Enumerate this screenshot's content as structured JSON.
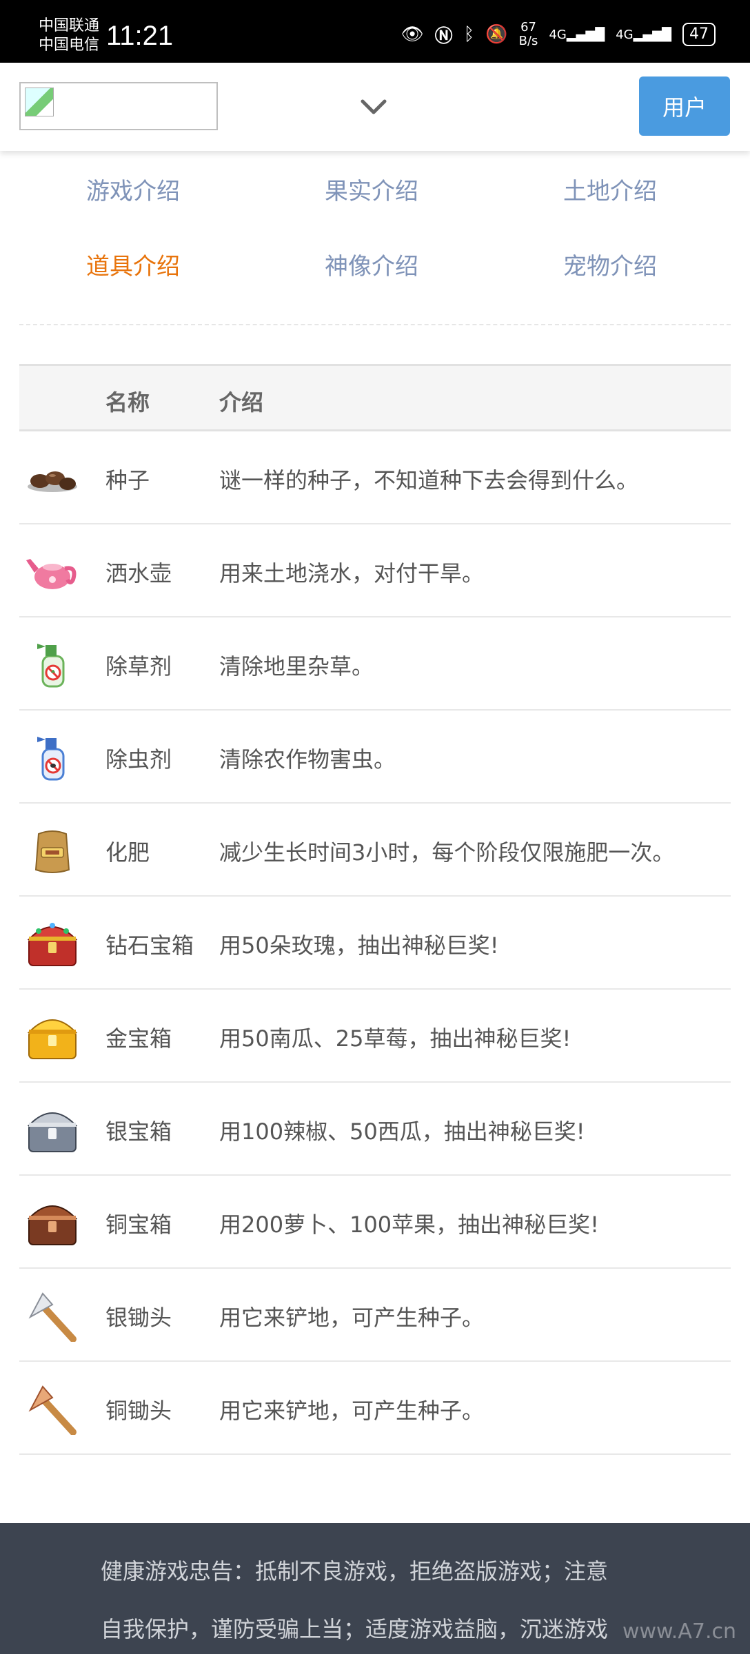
{
  "status_bar": {
    "carrier1": "中国联通",
    "carrier2": "中国电信",
    "time": "11:21",
    "speed_value": "67",
    "speed_unit": "B/s",
    "network1": "4G",
    "network2": "4G",
    "battery": "47"
  },
  "header": {
    "user_button": "用户"
  },
  "nav": {
    "items": [
      {
        "label": "游戏介绍"
      },
      {
        "label": "果实介绍"
      },
      {
        "label": "土地介绍"
      },
      {
        "label": "道具介绍"
      },
      {
        "label": "神像介绍"
      },
      {
        "label": "宠物介绍"
      }
    ],
    "active": "道具介绍"
  },
  "table": {
    "columns": [
      "名称",
      "介绍"
    ],
    "rows": [
      {
        "name": "种子",
        "desc": "谜一样的种子，不知道种下去会得到什么。",
        "icon": "seeds-icon"
      },
      {
        "name": "洒水壶",
        "desc": "用来土地浇水，对付干旱。",
        "icon": "watering-can-icon"
      },
      {
        "name": "除草剂",
        "desc": "清除地里杂草。",
        "icon": "herbicide-spray-icon"
      },
      {
        "name": "除虫剂",
        "desc": "清除农作物害虫。",
        "icon": "pesticide-spray-icon"
      },
      {
        "name": "化肥",
        "desc": "减少生长时间3小时，每个阶段仅限施肥一次。",
        "icon": "fertilizer-bag-icon"
      },
      {
        "name": "钻石宝箱",
        "desc": "用50朵玫瑰，抽出神秘巨奖!",
        "icon": "diamond-chest-icon"
      },
      {
        "name": "金宝箱",
        "desc": "用50南瓜、25草莓，抽出神秘巨奖!",
        "icon": "gold-chest-icon"
      },
      {
        "name": "银宝箱",
        "desc": "用100辣椒、50西瓜，抽出神秘巨奖!",
        "icon": "silver-chest-icon"
      },
      {
        "name": "铜宝箱",
        "desc": "用200萝卜、100苹果，抽出神秘巨奖!",
        "icon": "bronze-chest-icon"
      },
      {
        "name": "银锄头",
        "desc": "用它来铲地，可产生种子。",
        "icon": "silver-hoe-icon"
      },
      {
        "name": "铜锄头",
        "desc": "用它来铲地，可产生种子。",
        "icon": "bronze-hoe-icon"
      }
    ]
  },
  "footer": {
    "line1": "健康游戏忠告：抵制不良游戏，拒绝盗版游戏；注意",
    "line2": "自我保护，谨防受骗上当；适度游戏益脑，沉迷游戏",
    "watermark": "www.A7.cn"
  },
  "colors": {
    "accent": "#4a9be0",
    "active_tab": "#e8740c",
    "tab": "#7f93b8",
    "footer_bg": "#3d4450"
  }
}
